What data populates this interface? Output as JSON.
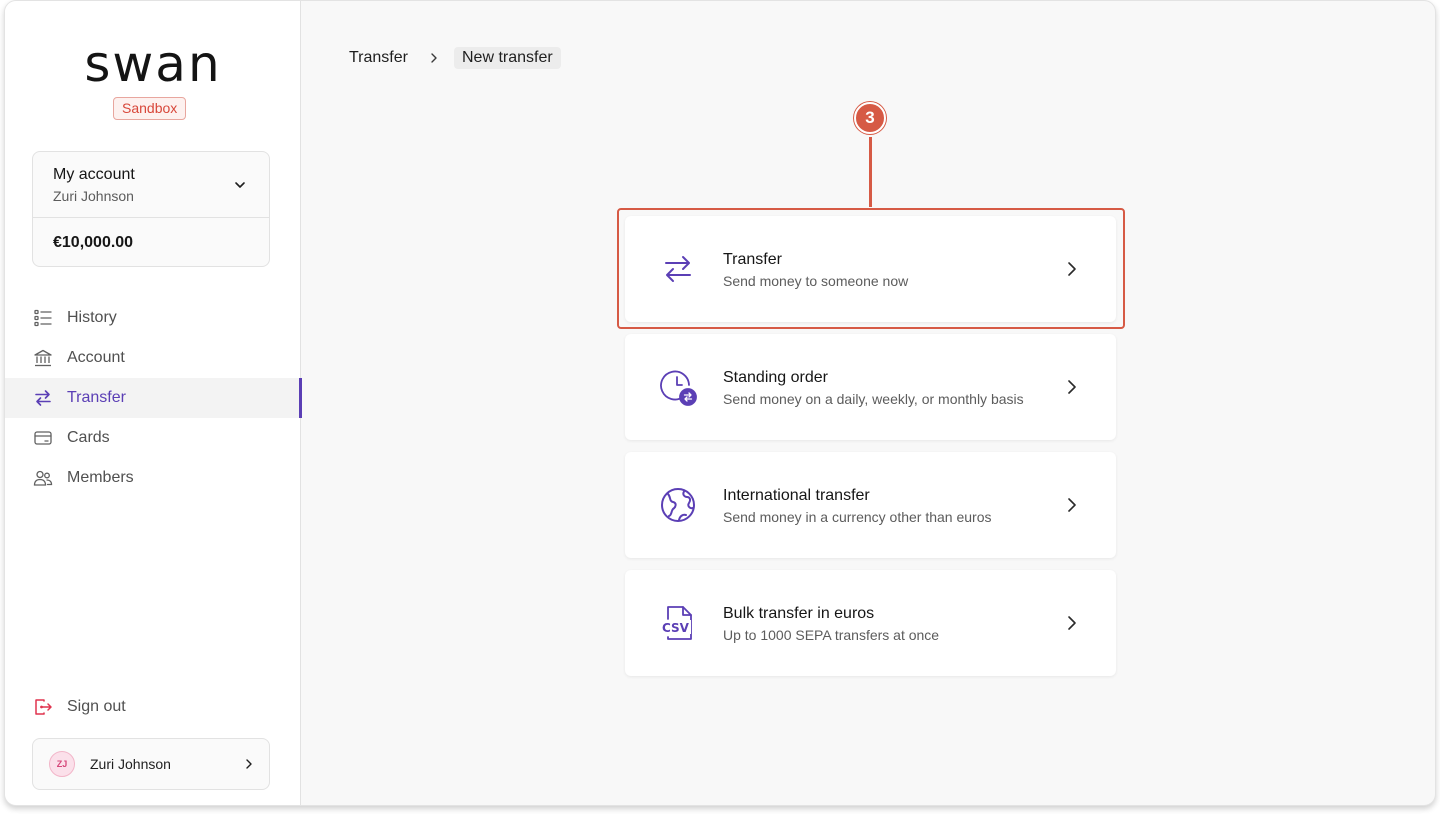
{
  "brand": {
    "logo_text": "swan",
    "env_badge": "Sandbox"
  },
  "account": {
    "name": "My account",
    "holder": "Zuri Johnson",
    "balance": "€10,000.00"
  },
  "nav": {
    "items": [
      {
        "label": "History",
        "icon": "list-icon"
      },
      {
        "label": "Account",
        "icon": "bank-icon"
      },
      {
        "label": "Transfer",
        "icon": "transfer-arrows-icon",
        "active": true
      },
      {
        "label": "Cards",
        "icon": "card-icon"
      },
      {
        "label": "Members",
        "icon": "members-icon"
      }
    ]
  },
  "footer": {
    "sign_out": "Sign out",
    "user_initials": "ZJ",
    "user_name": "Zuri Johnson"
  },
  "breadcrumb": {
    "parent": "Transfer",
    "current": "New transfer"
  },
  "annotation": {
    "step": "3"
  },
  "options": [
    {
      "title": "Transfer",
      "description": "Send money to someone now",
      "icon": "transfer-arrows-icon"
    },
    {
      "title": "Standing order",
      "description": "Send money on a daily, weekly, or monthly basis",
      "icon": "clock-repeat-icon"
    },
    {
      "title": "International transfer",
      "description": "Send money in a currency other than euros",
      "icon": "globe-icon"
    },
    {
      "title": "Bulk transfer in euros",
      "description": "Up to 1000 SEPA transfers at once",
      "icon": "csv-file-icon"
    }
  ],
  "colors": {
    "accent": "#5b3fb5",
    "annotation": "#d65a45",
    "sandbox": "#d8473a",
    "sign_out_icon": "#e0344f"
  }
}
